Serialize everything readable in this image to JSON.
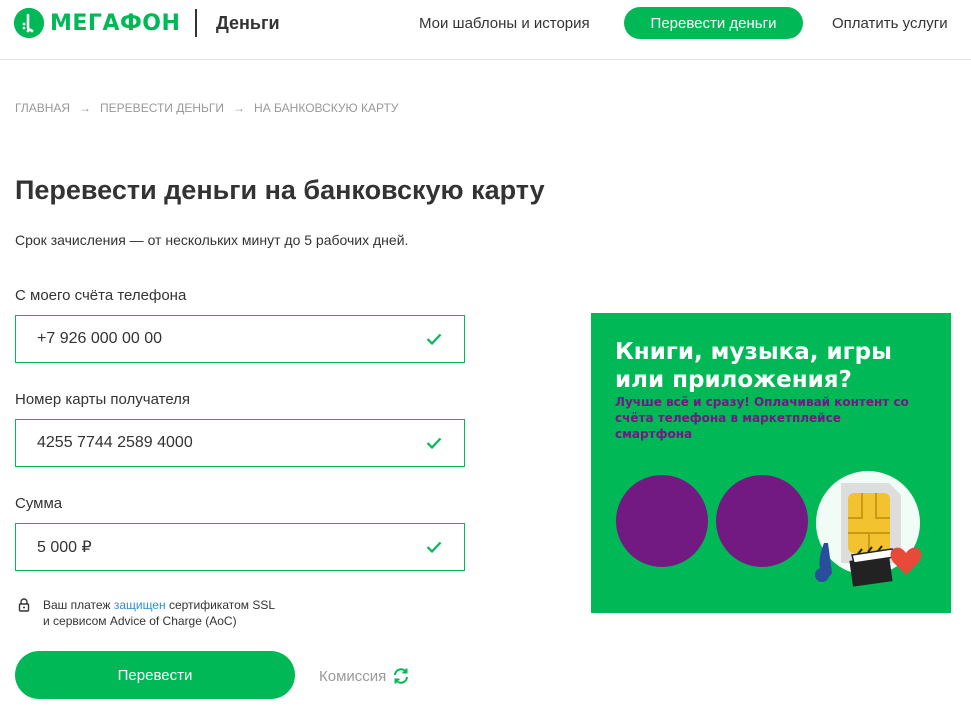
{
  "header": {
    "logo_text": "МЕГАФОН",
    "service_name": "Деньги",
    "nav": {
      "templates": "Мои шаблоны и история",
      "transfer": "Перевести деньги",
      "pay": "Оплатить услуги"
    }
  },
  "breadcrumb": {
    "items": [
      "ГЛАВНАЯ",
      "ПЕРЕВЕСТИ ДЕНЬГИ",
      "НА БАНКОВСКУЮ КАРТУ"
    ]
  },
  "page": {
    "title": "Перевести деньги на банковскую карту",
    "subtitle": "Срок зачисления — от нескольких минут до 5 рабочих дней."
  },
  "form": {
    "phone": {
      "label": "С моего счёта телефона",
      "value": "+7 926 000 00 00"
    },
    "card": {
      "label": "Номер карты получателя",
      "value": "4255 7744 2589 4000"
    },
    "amount": {
      "label": "Сумма",
      "value": "5 000 ₽"
    },
    "ssl": {
      "prefix": "Ваш платеж ",
      "link": "защищен",
      "suffix": " сертификатом SSL",
      "line2": "и сервисом Advice of Charge (AoC)"
    },
    "submit_label": "Перевести",
    "commission_label": "Комиссия"
  },
  "banner": {
    "title": "Книги, музыка, игры или приложения?",
    "text": "Лучше всё и сразу! Оплачивай контент со счёта телефона в маркетплейсе смартфона"
  },
  "colors": {
    "brand_green": "#00b956",
    "brand_purple": "#731982",
    "link_blue": "#2d8fd6",
    "text_dark": "#333333",
    "text_muted": "#999999"
  }
}
